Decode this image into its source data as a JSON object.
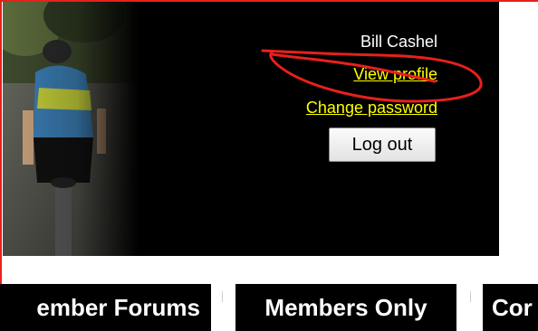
{
  "header": {
    "user_name": "Bill Cashel",
    "view_profile_link": "View profile",
    "change_password_link": "Change password",
    "logout_button": "Log out"
  },
  "nav": {
    "tabs": [
      {
        "label": "ember Forums"
      },
      {
        "label": "Members Only"
      },
      {
        "label": "Cor"
      }
    ]
  },
  "colors": {
    "border": "#e8201c",
    "banner_background": "#000000",
    "link": "#ffff00",
    "annotation": "#e8201c"
  },
  "icons": {
    "photo": "cyclist-photo"
  }
}
